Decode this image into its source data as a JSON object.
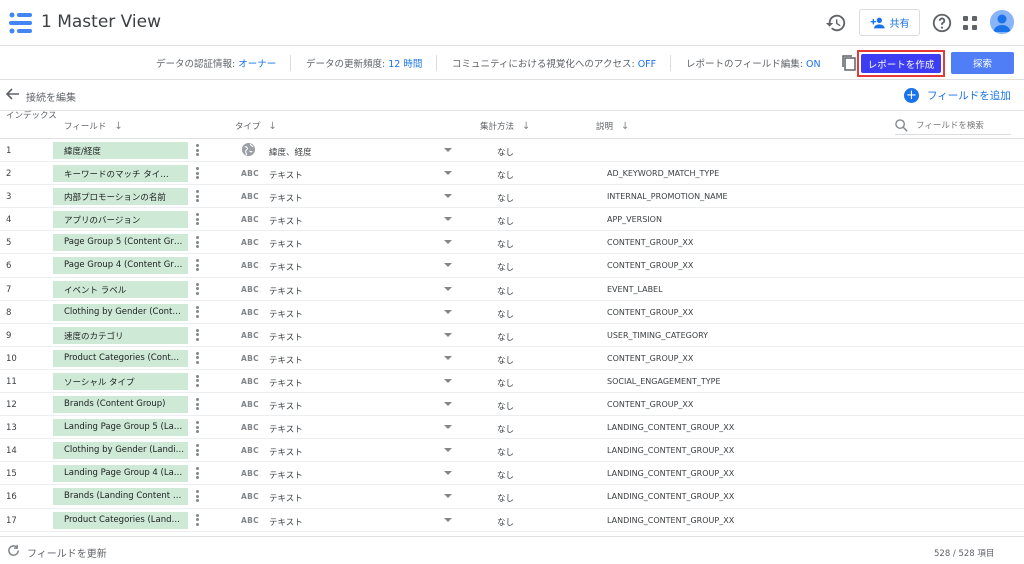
{
  "header": {
    "title": "1 Master View",
    "share_label": "共有"
  },
  "infobar": {
    "credentials_label": "データの認証情報: ",
    "credentials_value": "オーナー",
    "refresh_label": "データの更新頻度: ",
    "refresh_value": "12 時間",
    "community_label": "コミュニティにおける視覚化へのアクセス: ",
    "community_value": "OFF",
    "field_edit_label": "レポートのフィールド編集: ",
    "field_edit_value": "ON",
    "create_report": "レポートを作成",
    "explore": "探索"
  },
  "editbar": {
    "edit_connection": "接続を編集",
    "add_field": "フィールドを追加"
  },
  "table": {
    "col_index": "インデックス",
    "col_field": "フィールド",
    "col_type": "タイプ",
    "col_agg": "集計方法",
    "col_desc": "説明",
    "search_placeholder": "フィールドを検索",
    "rows": [
      {
        "idx": "1",
        "field": "緯度/経度",
        "type_icon": "globe-icon",
        "type": "緯度、経度",
        "agg": "なし",
        "desc": ""
      },
      {
        "idx": "2",
        "field": "キーワードのマッチ タイ…",
        "type_icon": "abc-icon",
        "type": "テキスト",
        "agg": "なし",
        "desc": "AD_KEYWORD_MATCH_TYPE"
      },
      {
        "idx": "3",
        "field": "内部プロモーションの名前",
        "type_icon": "abc-icon",
        "type": "テキスト",
        "agg": "なし",
        "desc": "INTERNAL_PROMOTION_NAME"
      },
      {
        "idx": "4",
        "field": "アプリのバージョン",
        "type_icon": "abc-icon",
        "type": "テキスト",
        "agg": "なし",
        "desc": "APP_VERSION"
      },
      {
        "idx": "5",
        "field": "Page Group 5 (Content Gr…",
        "type_icon": "abc-icon",
        "type": "テキスト",
        "agg": "なし",
        "desc": "CONTENT_GROUP_XX"
      },
      {
        "idx": "6",
        "field": "Page Group 4 (Content Gr…",
        "type_icon": "abc-icon",
        "type": "テキスト",
        "agg": "なし",
        "desc": "CONTENT_GROUP_XX"
      },
      {
        "idx": "7",
        "field": "イベント ラベル",
        "type_icon": "abc-icon",
        "type": "テキスト",
        "agg": "なし",
        "desc": "EVENT_LABEL"
      },
      {
        "idx": "8",
        "field": "Clothing by Gender (Cont…",
        "type_icon": "abc-icon",
        "type": "テキスト",
        "agg": "なし",
        "desc": "CONTENT_GROUP_XX"
      },
      {
        "idx": "9",
        "field": "速度のカテゴリ",
        "type_icon": "abc-icon",
        "type": "テキスト",
        "agg": "なし",
        "desc": "USER_TIMING_CATEGORY"
      },
      {
        "idx": "10",
        "field": "Product Categories (Cont…",
        "type_icon": "abc-icon",
        "type": "テキスト",
        "agg": "なし",
        "desc": "CONTENT_GROUP_XX"
      },
      {
        "idx": "11",
        "field": "ソーシャル タイプ",
        "type_icon": "abc-icon",
        "type": "テキスト",
        "agg": "なし",
        "desc": "SOCIAL_ENGAGEMENT_TYPE"
      },
      {
        "idx": "12",
        "field": "Brands (Content Group)",
        "type_icon": "abc-icon",
        "type": "テキスト",
        "agg": "なし",
        "desc": "CONTENT_GROUP_XX"
      },
      {
        "idx": "13",
        "field": "Landing Page Group 5 (La…",
        "type_icon": "abc-icon",
        "type": "テキスト",
        "agg": "なし",
        "desc": "LANDING_CONTENT_GROUP_XX"
      },
      {
        "idx": "14",
        "field": "Clothing by Gender (Landi…",
        "type_icon": "abc-icon",
        "type": "テキスト",
        "agg": "なし",
        "desc": "LANDING_CONTENT_GROUP_XX"
      },
      {
        "idx": "15",
        "field": "Landing Page Group 4 (La…",
        "type_icon": "abc-icon",
        "type": "テキスト",
        "agg": "なし",
        "desc": "LANDING_CONTENT_GROUP_XX"
      },
      {
        "idx": "16",
        "field": "Brands (Landing Content …",
        "type_icon": "abc-icon",
        "type": "テキスト",
        "agg": "なし",
        "desc": "LANDING_CONTENT_GROUP_XX"
      },
      {
        "idx": "17",
        "field": "Product Categories (Land…",
        "type_icon": "abc-icon",
        "type": "テキスト",
        "agg": "なし",
        "desc": "LANDING_CONTENT_GROUP_XX"
      }
    ],
    "abc_glyph": "ABC"
  },
  "footer": {
    "refresh_fields": "フィールドを更新",
    "count": "528 / 528 項目"
  },
  "colors": {
    "accent": "#1a73e8",
    "create_report_bg": "#3d3df5",
    "highlight_border": "#e53935",
    "field_chip": "#ceead6"
  }
}
